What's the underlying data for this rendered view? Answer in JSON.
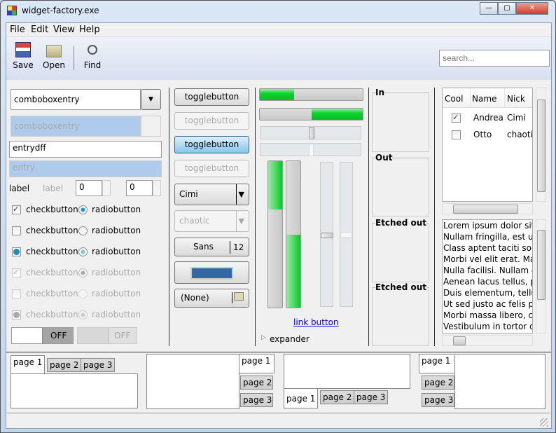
{
  "window": {
    "title": "widget-factory.exe",
    "min": "—",
    "max": "▢",
    "close": "✕"
  },
  "menu": [
    "File",
    "Edit",
    "View",
    "Help"
  ],
  "toolbar": {
    "save": "Save",
    "open": "Open",
    "find": "Find",
    "search_placeholder": "search..."
  },
  "left": {
    "combo1": "comboboxentry",
    "combo2": "comboboxentry",
    "entry1": "entrydff",
    "entry2": "entry",
    "label1": "label",
    "label2": "label",
    "spin1": "0",
    "spin2": "0",
    "check": "checkbutton",
    "radio": "radiobutton",
    "switch1": "OFF",
    "switch2": "OFF"
  },
  "middle": {
    "toggle": "togglebutton",
    "combo1": "Cimi",
    "combo2": "chaotic",
    "font": "Sans",
    "font_size": "12",
    "file": "(None)",
    "color": "#3465a4"
  },
  "progress": {
    "bar1": 0.33,
    "bar2": 0.5,
    "vbar1": 0.33,
    "vbar2": 0.5,
    "hscale1": 0.5,
    "hscale2": 0.5,
    "vscale1": 0.5,
    "vscale2": 0.5
  },
  "link": "link button",
  "expander": "expander",
  "frames": [
    "In",
    "Out",
    "Etched out",
    "Etched out"
  ],
  "tree": {
    "headers": [
      "Cool",
      "Name",
      "Nick"
    ],
    "rows": [
      {
        "cool": true,
        "name": "Andrea",
        "nick": "Cimi"
      },
      {
        "cool": false,
        "name": "Otto",
        "nick": "chaotic"
      }
    ]
  },
  "text": [
    "Lorem ipsum dolor sit",
    "Nullam fringilla, est ut",
    "Class aptent taciti soci",
    "Morbi vel elit erat. Mae",
    "Nulla facilisi. Nullam el",
    "Aenean lacus tellus, pe",
    "Duis elementum, tellus",
    "Ut sed justo ac felis pla",
    "Morbi massa libero, cc",
    "Vestibulum in tortor di"
  ],
  "tabs": [
    "page 1",
    "page 2",
    "page 3"
  ]
}
